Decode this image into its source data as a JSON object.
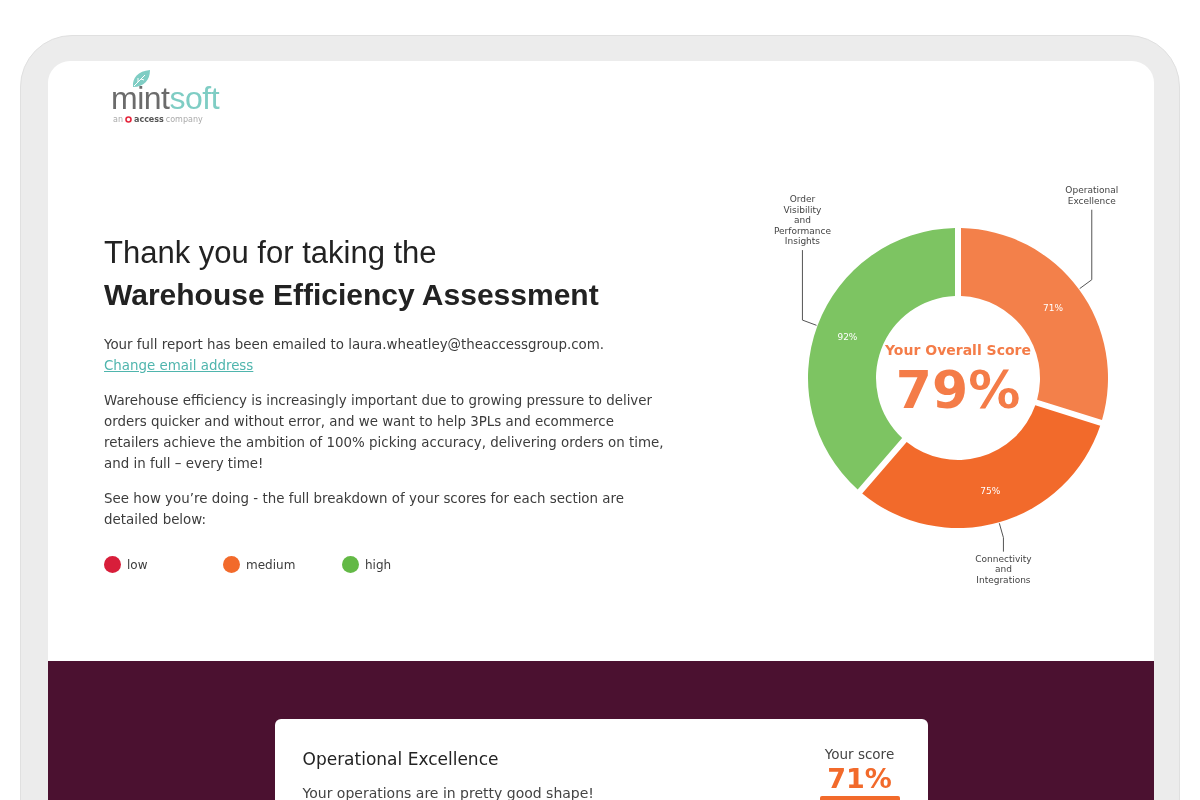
{
  "logo": {
    "wordmark_left": "mint",
    "wordmark_right": "soft",
    "tagline_prefix": "an",
    "tagline_brand": "access",
    "tagline_suffix": "company"
  },
  "hero": {
    "heading_light": "Thank you for taking the",
    "heading_bold": "Warehouse Efficiency Assessment",
    "email_notice": {
      "text": "Your full report has been emailed to laura.wheatley@theaccessgroup.com.",
      "link": "Change email address"
    },
    "paragraphs": [
      "Warehouse efficiency is increasingly important due to growing pressure to deliver orders quicker and without error, and we want to help 3PLs and ecommerce retailers achieve the ambition of 100% picking accuracy, delivering orders on time, and in full – every time!",
      "See how you’re doing - the full breakdown of your scores for each section are detailed below:"
    ],
    "legend": [
      {
        "label": "low",
        "color": "#d81e3a"
      },
      {
        "label": "medium",
        "color": "#f26a2b"
      },
      {
        "label": "high",
        "color": "#63b946"
      }
    ]
  },
  "score_chart": {
    "center_title": "Your Overall Score",
    "center_value": "79%",
    "chart_data": {
      "type": "donut",
      "categories": [
        "Operational Excellence",
        "Connectivity and Integrations",
        "Order Visibility and Performance Insights"
      ],
      "values": [
        71,
        75,
        92
      ],
      "colors": [
        "#f3804a",
        "#f26a2b",
        "#7dc462"
      ],
      "value_labels": [
        "71%",
        "75%",
        "92%"
      ]
    }
  },
  "section_card": {
    "title": "Operational Excellence",
    "summary": "Your operations are in pretty good shape!",
    "score_label": "Your score",
    "score_value": "71%"
  }
}
